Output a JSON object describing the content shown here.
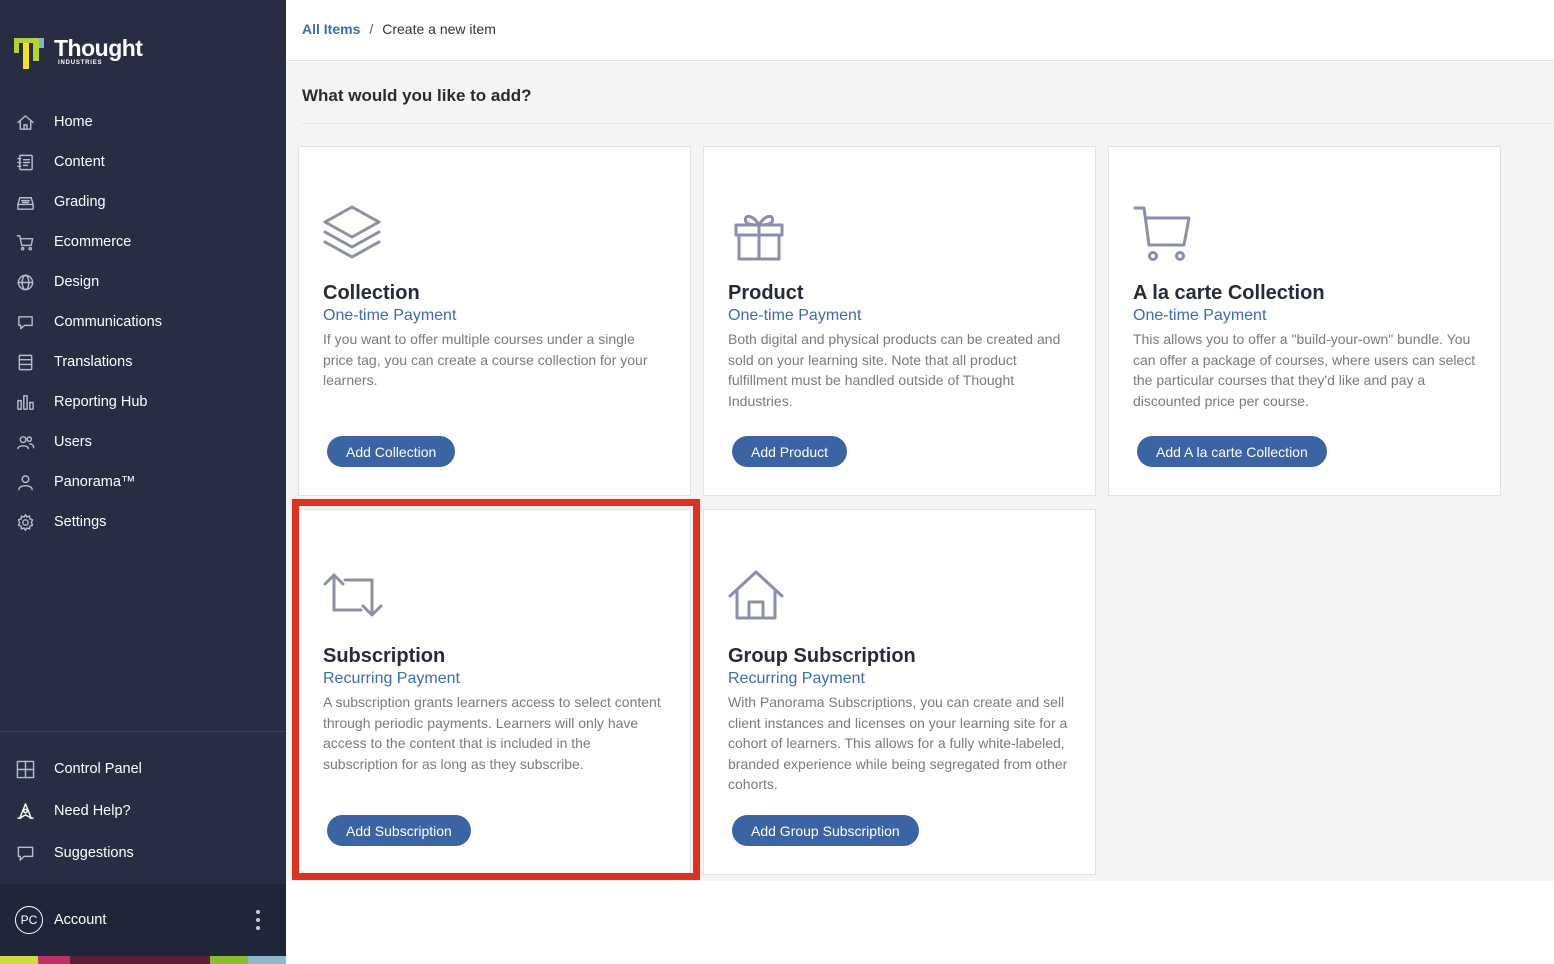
{
  "brand": {
    "name": "Thought",
    "sub": "INDUSTRIES"
  },
  "sidebar": {
    "items": [
      {
        "label": "Home",
        "icon": "home-icon"
      },
      {
        "label": "Content",
        "icon": "content-icon"
      },
      {
        "label": "Grading",
        "icon": "grading-icon"
      },
      {
        "label": "Ecommerce",
        "icon": "cart-icon"
      },
      {
        "label": "Design",
        "icon": "globe-icon"
      },
      {
        "label": "Communications",
        "icon": "chat-icon"
      },
      {
        "label": "Translations",
        "icon": "translations-icon"
      },
      {
        "label": "Reporting Hub",
        "icon": "bar-chart-icon"
      },
      {
        "label": "Users",
        "icon": "users-icon"
      },
      {
        "label": "Panorama™",
        "icon": "user-icon"
      },
      {
        "label": "Settings",
        "icon": "gear-icon"
      }
    ],
    "bottom": [
      {
        "label": "Control Panel",
        "icon": "grid-icon"
      },
      {
        "label": "Need Help?",
        "icon": "help-icon"
      },
      {
        "label": "Suggestions",
        "icon": "speech-bubble-icon"
      }
    ],
    "account": {
      "initials": "PC",
      "label": "Account"
    }
  },
  "breadcrumb": {
    "link": "All Items",
    "separator": "/",
    "current": "Create a new item"
  },
  "page": {
    "heading": "What would you like to add?"
  },
  "cards": [
    {
      "title": "Collection",
      "subtitle": "One-time Payment",
      "description": "If you want to offer multiple courses under a single price tag, you can create a course collection for your learners.",
      "button": "Add Collection",
      "icon": "layers-icon"
    },
    {
      "title": "Product",
      "subtitle": "One-time Payment",
      "description": "Both digital and physical products can be created and sold on your learning site. Note that all product fulfillment must be handled outside of Thought Industries.",
      "button": "Add Product",
      "icon": "gift-icon"
    },
    {
      "title": "A la carte Collection",
      "subtitle": "One-time Payment",
      "description": "This allows you to offer a \"build-your-own\" bundle. You can offer a package of courses, where users can select the particular courses that they'd like and pay a discounted price per course.",
      "button": "Add A la carte Collection",
      "icon": "shopping-cart-icon"
    },
    {
      "title": "Subscription",
      "subtitle": "Recurring Payment",
      "description": "A subscription grants learners access to select content through periodic payments. Learners will only have access to the content that is included in the subscription for as long as they subscribe.",
      "button": "Add Subscription",
      "icon": "repeat-icon"
    },
    {
      "title": "Group Subscription",
      "subtitle": "Recurring Payment",
      "description": "With Panorama Subscriptions, you can create and sell client instances and licenses on your learning site for a cohort of learners. This allows for a fully white-labeled, branded experience while being segregated from other cohorts.",
      "button": "Add Group Subscription",
      "icon": "house-icon"
    }
  ],
  "colors": {
    "sidebar_bg": "#272e43",
    "accent_blue": "#3b6cb5",
    "button_blue": "#3a64a3",
    "highlight_red": "#e0311c",
    "logo_green": "#b6d334",
    "logo_yellow": "#f3e41d"
  }
}
